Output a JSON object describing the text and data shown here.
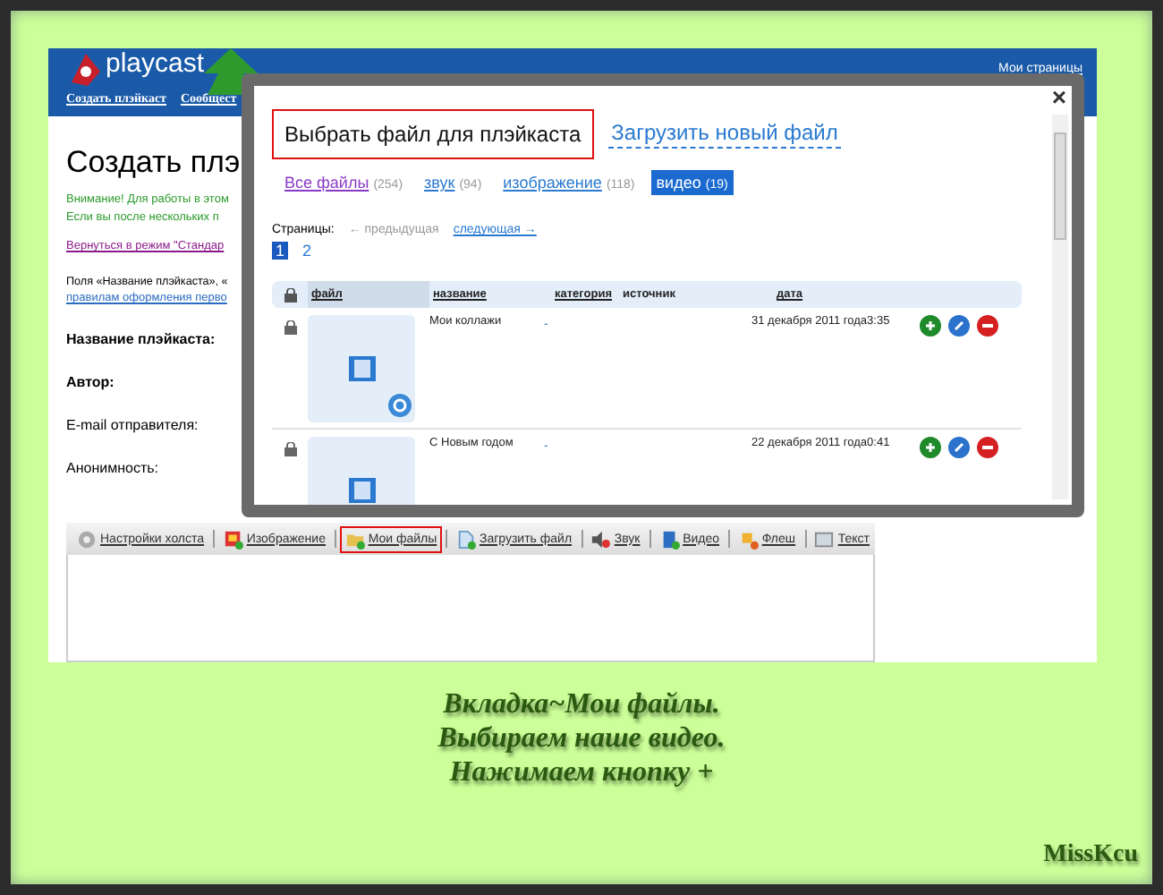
{
  "header": {
    "logo": "playcast",
    "nav": [
      "Создать плэйкаст",
      "Сообщест"
    ],
    "top_links": [
      "Мои страницы"
    ]
  },
  "page": {
    "title": "Создать плэ",
    "notices": [
      "Внимание! Для работы в этом",
      "Если вы после нескольких п"
    ],
    "return_link": "Вернуться в режим \"Стандар",
    "fields_note": "Поля «Название плэйкаста», «",
    "rules_link": "правилам оформления перво",
    "form_labels": [
      {
        "label": "Название плэйкаста:",
        "bold": true
      },
      {
        "label": "Автор:",
        "bold": true
      },
      {
        "label": "E-mail отправителя:",
        "bold": false
      },
      {
        "label": "Анонимность:",
        "bold": false
      }
    ]
  },
  "toolbar": [
    {
      "label": "Настройки холста",
      "kind": "gear",
      "highlighted": false
    },
    {
      "label": "Изображение",
      "kind": "image",
      "highlighted": false
    },
    {
      "label": "Мои файлы",
      "kind": "folder",
      "highlighted": true
    },
    {
      "label": "Загрузить файл",
      "kind": "file",
      "highlighted": false
    },
    {
      "label": "Звук",
      "kind": "sound",
      "highlighted": false
    },
    {
      "label": "Видео",
      "kind": "video",
      "highlighted": false
    },
    {
      "label": "Флеш",
      "kind": "flash",
      "highlighted": false
    },
    {
      "label": "Текст",
      "kind": "text",
      "highlighted": false
    }
  ],
  "dialog": {
    "close": "×",
    "tabs": [
      {
        "label": "Выбрать файл для плэйкаста",
        "selected": true
      },
      {
        "label": "Загрузить новый файл",
        "selected": false
      }
    ],
    "filters": [
      {
        "label": "Все файлы",
        "count": "(254)",
        "selected": false,
        "visited": true
      },
      {
        "label": "звук",
        "count": "(94)",
        "selected": false,
        "visited": false
      },
      {
        "label": "изображение",
        "count": "(118)",
        "selected": false,
        "visited": false
      },
      {
        "label": "видео",
        "count": "(19)",
        "selected": true,
        "visited": false
      }
    ],
    "pages_label": "Страницы:",
    "prev": "← предыдущая",
    "next": "следующая →",
    "pages": [
      {
        "label": "1",
        "selected": true
      },
      {
        "label": "2",
        "selected": false
      }
    ],
    "columns": [
      {
        "label": "файл",
        "sortable": true,
        "sorted": true
      },
      {
        "label": "название",
        "sortable": true,
        "sorted": false
      },
      {
        "label": "категория",
        "sortable": true,
        "sorted": false
      },
      {
        "label": "источник",
        "sortable": false,
        "sorted": false
      },
      {
        "label": "дата",
        "sortable": true,
        "sorted": false
      }
    ],
    "rows": [
      {
        "name": "Мои коллажи",
        "category": "-",
        "date": "31 декабря 2011 года3:35"
      },
      {
        "name": "С Новым годом",
        "category": "-",
        "date": "22 декабря 2011 года0:41"
      }
    ]
  },
  "caption": {
    "lines": [
      "Вкладка~Мои файлы.",
      "Выбираем наше видео.",
      "Нажимаем кнопку +"
    ],
    "signature": "MissKcu"
  }
}
